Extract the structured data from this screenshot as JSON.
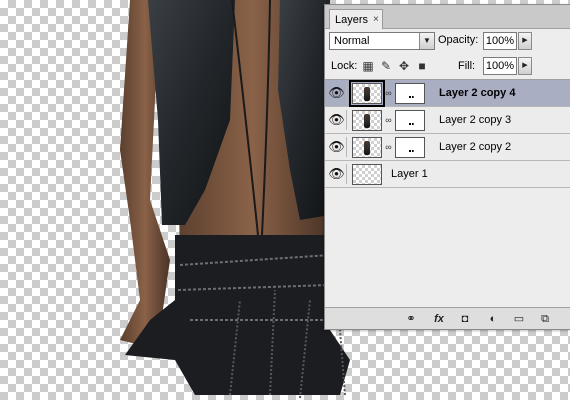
{
  "panel": {
    "tab_label": "Layers",
    "tab_close": "×",
    "blend_mode": "Normal",
    "opacity_label": "Opacity:",
    "opacity_value": "100%",
    "lock_label": "Lock:",
    "fill_label": "Fill:",
    "fill_value": "100%"
  },
  "layers": [
    {
      "name": "Layer 2 copy 4",
      "selected": true,
      "visible": true,
      "has_mask": true
    },
    {
      "name": "Layer 2 copy 3",
      "selected": false,
      "visible": true,
      "has_mask": true
    },
    {
      "name": "Layer 2 copy 2",
      "selected": false,
      "visible": true,
      "has_mask": true
    },
    {
      "name": "Layer 1",
      "selected": false,
      "visible": true,
      "has_mask": false
    }
  ],
  "icons": {
    "eye": "eye-icon",
    "link_chain": "link-chain-icon",
    "lock_transparent": "lock-transparent-pixels-icon",
    "lock_image": "lock-image-pixels-icon",
    "lock_position": "lock-position-icon",
    "lock_all": "lock-all-icon",
    "footer": [
      "link-layers-icon",
      "fx-icon",
      "add-mask-icon",
      "adjustment-layer-icon",
      "new-group-icon",
      "new-layer-icon"
    ]
  },
  "colors": {
    "panel_bg": "#ededed",
    "selected_row": "#a9aec3",
    "checker": "#cccccc"
  }
}
